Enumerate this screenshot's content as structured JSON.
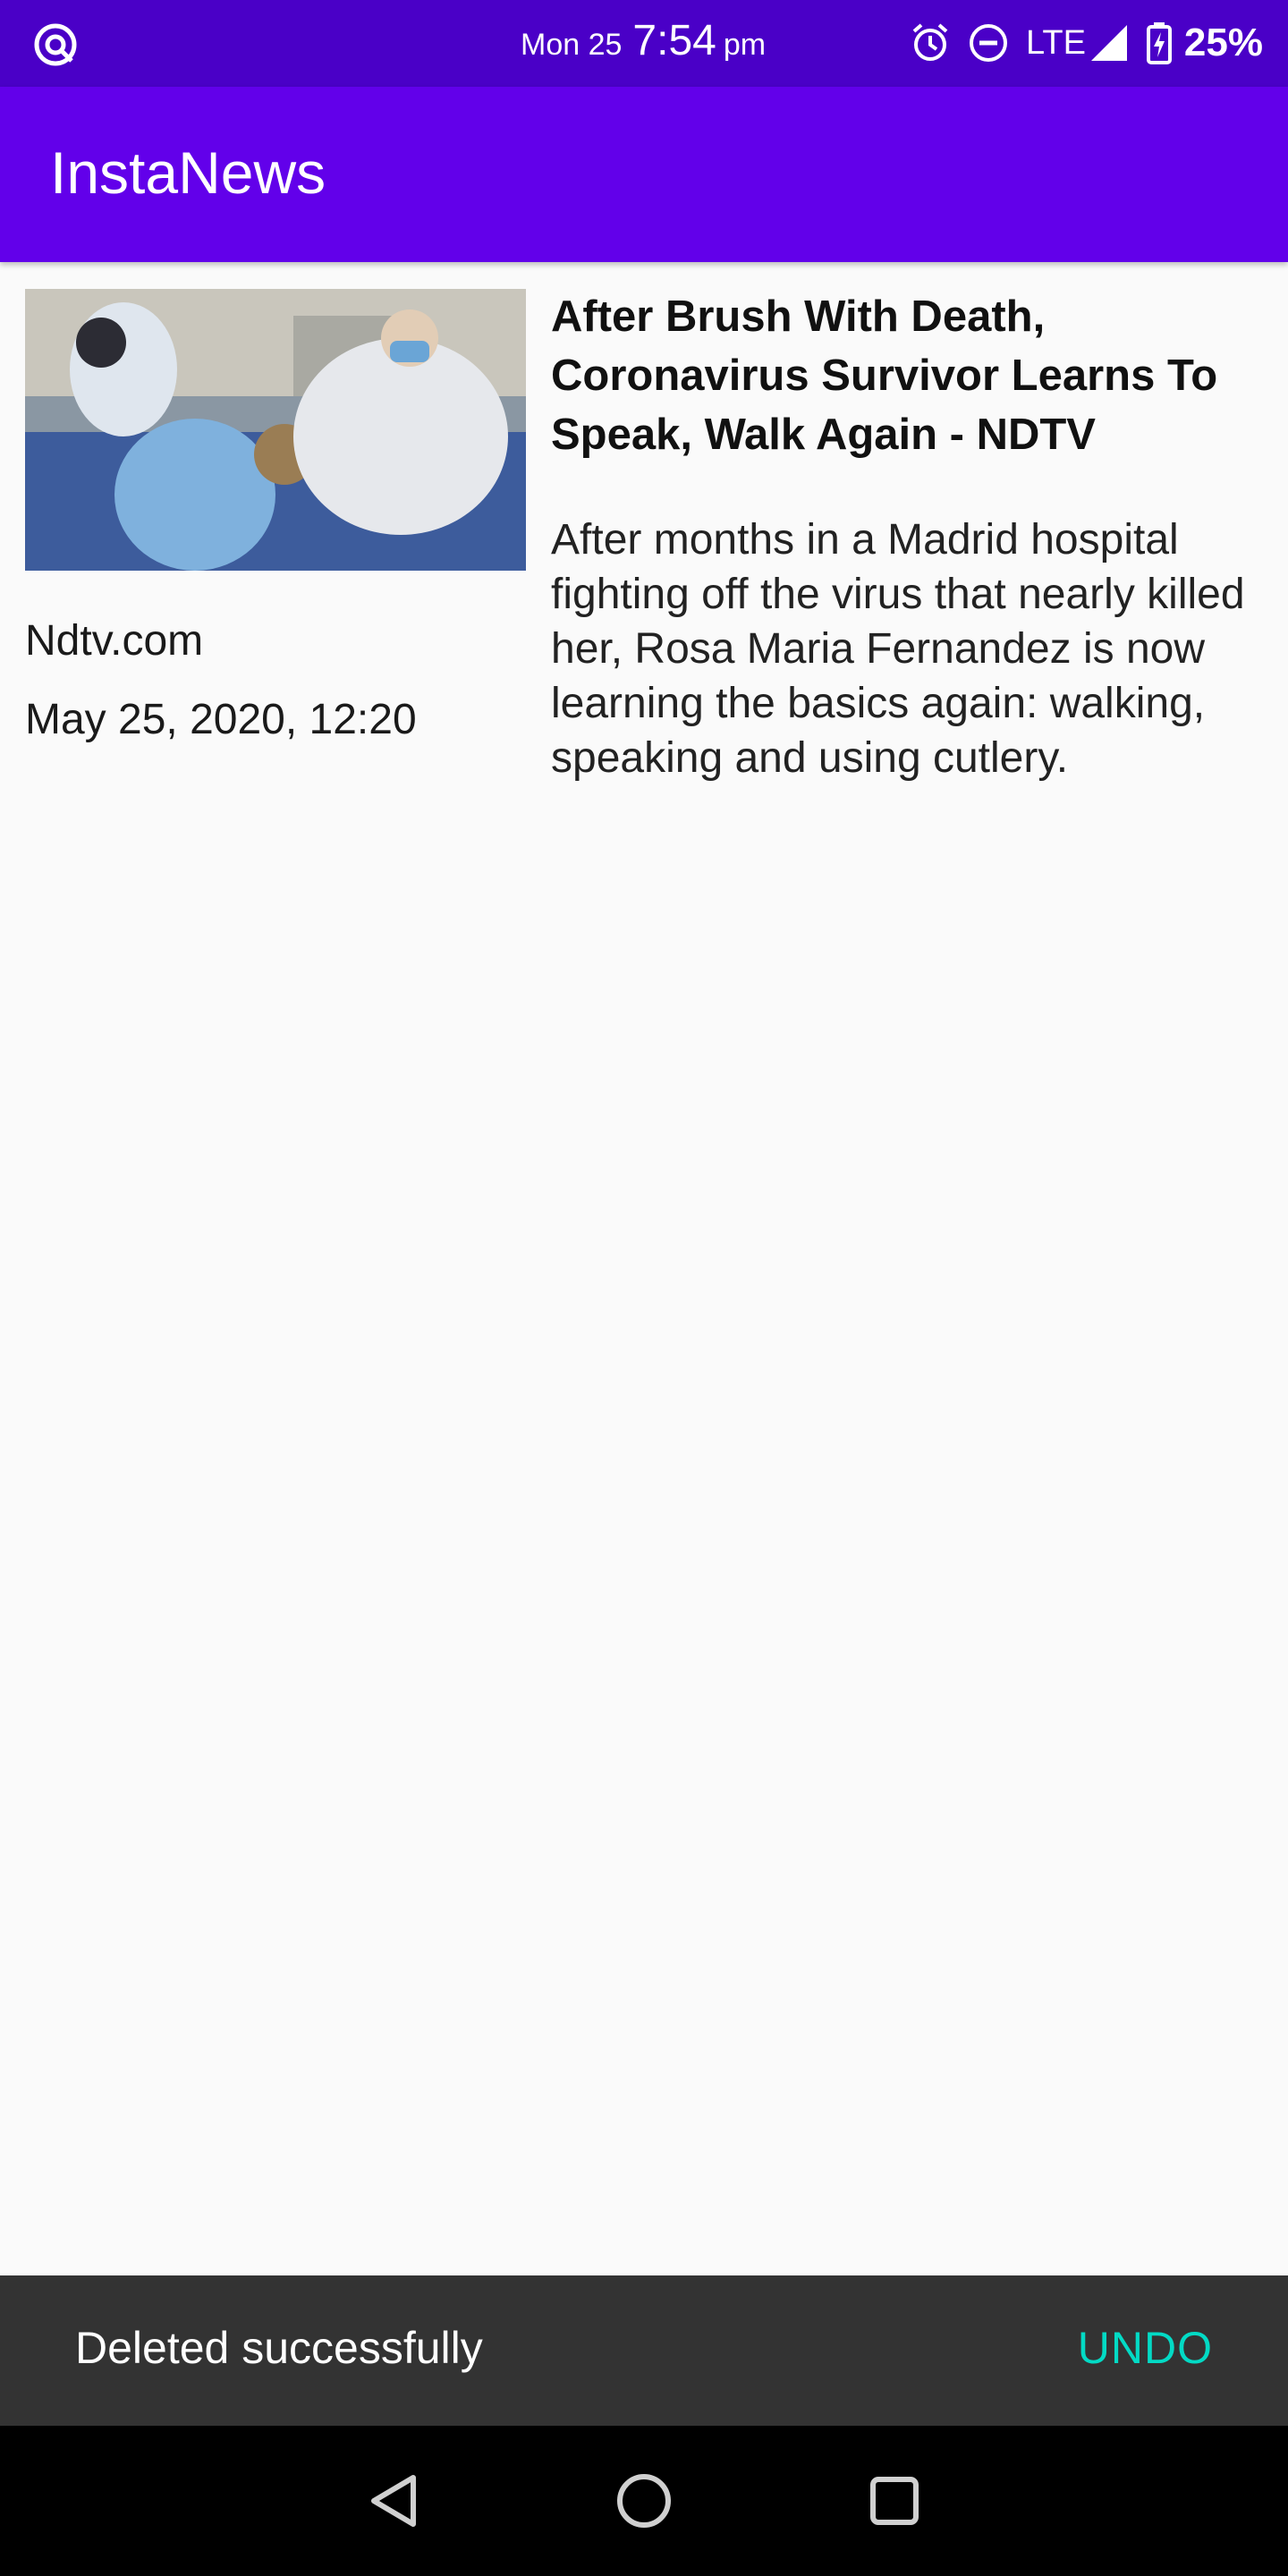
{
  "status_bar": {
    "day": "Mon 25",
    "time": "7:54",
    "ampm": "pm",
    "network": "LTE",
    "battery": "25%",
    "icons": [
      "app-notification-icon",
      "alarm-icon",
      "do-not-disturb-icon",
      "signal-icon",
      "battery-charging-icon"
    ]
  },
  "app_bar": {
    "title": "InstaNews"
  },
  "articles": [
    {
      "title": "After Brush With Death, Coronavirus Survivor Learns To Speak, Walk Again - NDTV",
      "description": "After months in a Madrid hospital fighting off the virus that nearly killed her, Rosa Maria Fernandez is now learning the basics again: walking, speaking and using cutlery.",
      "source": "Ndtv.com",
      "date": "May 25, 2020, 12:20"
    }
  ],
  "snackbar": {
    "message": "Deleted successfully",
    "action": "UNDO"
  },
  "nav_bar": {
    "buttons": [
      "back-icon",
      "home-icon",
      "recents-icon"
    ]
  },
  "colors": {
    "status_bar": "#4a00c7",
    "app_bar": "#6200ea",
    "snackbar_bg": "#333333",
    "snackbar_action": "#03dac5",
    "background": "#fafafa"
  }
}
